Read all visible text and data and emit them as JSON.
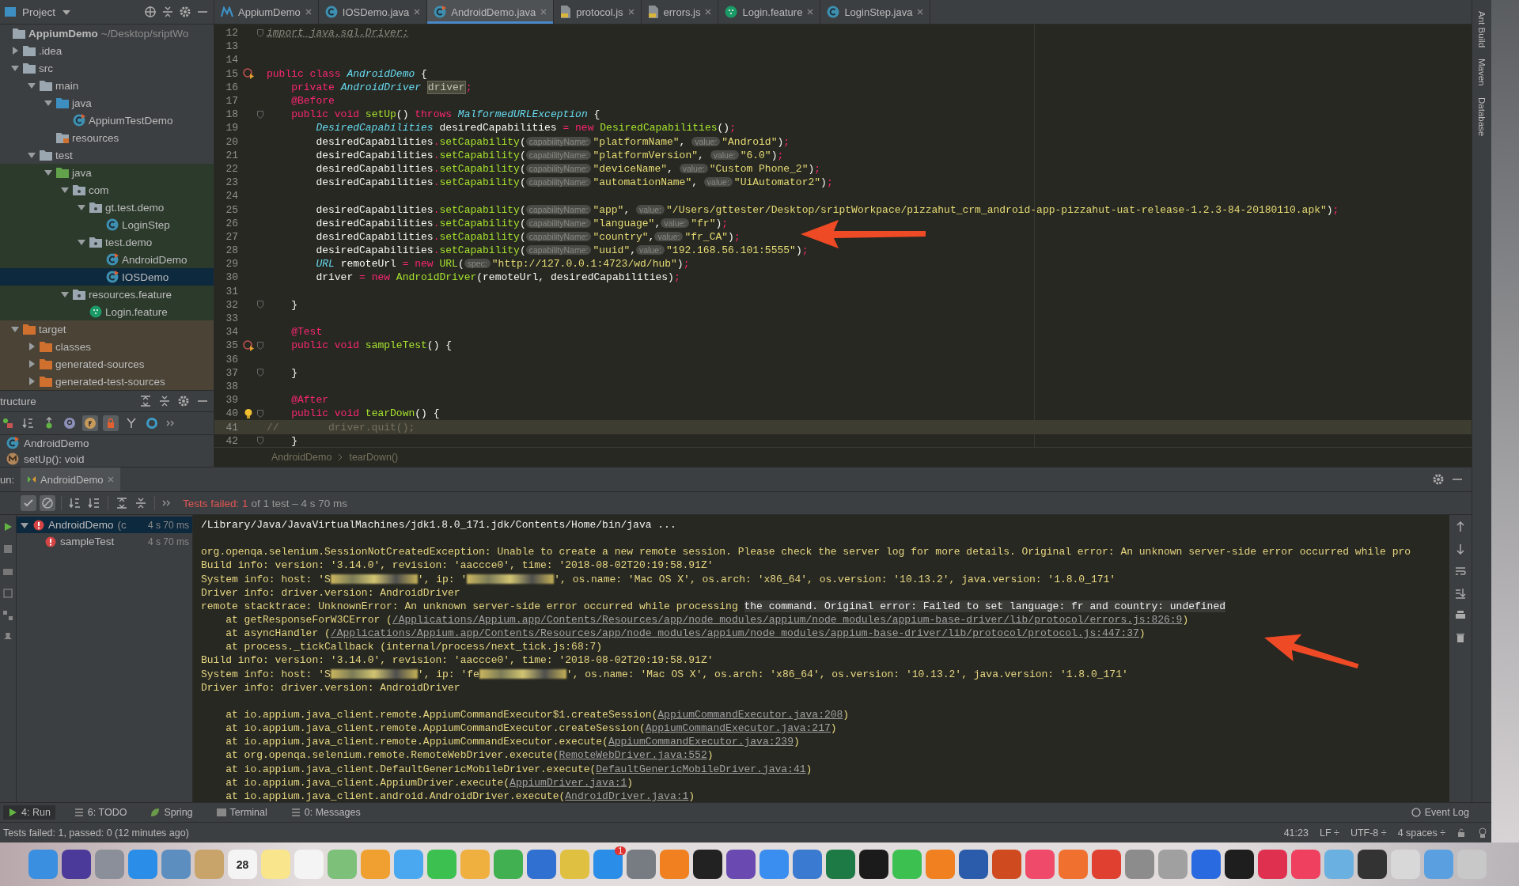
{
  "project_panel": {
    "title": "Project",
    "tree": [
      {
        "label": "AppiumDemo",
        "detail": "~/Desktop/sriptWo",
        "kind": "module",
        "selected": false,
        "children": [
          {
            "label": ".idea",
            "kind": "folder",
            "expanded": false,
            "selected": false
          },
          {
            "label": "src",
            "kind": "folder",
            "expanded": true,
            "selected": false,
            "children": [
              {
                "label": "main",
                "kind": "folder",
                "expanded": true,
                "selected": false,
                "children": [
                  {
                    "label": "java",
                    "kind": "src-folder",
                    "expanded": true,
                    "selected": false,
                    "children": [
                      {
                        "label": "AppiumTestDemo",
                        "kind": "class-run",
                        "selected": false
                      }
                    ]
                  },
                  {
                    "label": "resources",
                    "kind": "res-folder",
                    "selected": false
                  }
                ]
              },
              {
                "label": "test",
                "kind": "folder",
                "expanded": true,
                "selected": false,
                "children": [
                  {
                    "label": "java",
                    "kind": "test-folder",
                    "expanded": true,
                    "test_sources": true,
                    "selected": false,
                    "children": [
                      {
                        "label": "com",
                        "kind": "package",
                        "expanded": true,
                        "selected": false,
                        "children": [
                          {
                            "label": "gt.test.demo",
                            "kind": "package",
                            "expanded": true,
                            "selected": false,
                            "children": [
                              {
                                "label": "LoginStep",
                                "kind": "class",
                                "selected": false
                              }
                            ]
                          },
                          {
                            "label": "test.demo",
                            "kind": "package",
                            "expanded": true,
                            "selected": false,
                            "children": [
                              {
                                "label": "AndroidDemo",
                                "kind": "class-run",
                                "selected": false
                              },
                              {
                                "label": "IOSDemo",
                                "kind": "class-run",
                                "selected": true
                              }
                            ]
                          }
                        ]
                      },
                      {
                        "label": "resources.feature",
                        "kind": "package",
                        "expanded": true,
                        "selected": false,
                        "children": [
                          {
                            "label": "Login.feature",
                            "kind": "feature",
                            "selected": false
                          }
                        ]
                      }
                    ]
                  }
                ]
              }
            ]
          },
          {
            "label": "target",
            "kind": "excluded-folder",
            "expanded": true,
            "excluded": true,
            "selected": false,
            "children": [
              {
                "label": "classes",
                "kind": "excluded-folder",
                "expanded": false,
                "selected": false
              },
              {
                "label": "generated-sources",
                "kind": "excluded-folder",
                "expanded": false,
                "selected": false
              },
              {
                "label": "generated-test-sources",
                "kind": "excluded-folder",
                "expanded": false,
                "selected": false
              }
            ]
          }
        ]
      }
    ]
  },
  "structure_panel": {
    "title": "tructure",
    "tools": [
      {
        "kind": "visibility",
        "on": false
      },
      {
        "kind": "alpha",
        "on": false
      },
      {
        "kind": "inherited",
        "on": false
      },
      {
        "kind": "p",
        "on": false
      },
      {
        "kind": "f",
        "on": true
      },
      {
        "kind": "lock",
        "on": true
      },
      {
        "kind": "tree",
        "on": false
      },
      {
        "kind": "ring",
        "on": false
      }
    ],
    "items": [
      {
        "label": "AndroidDemo",
        "kind": "class-run"
      },
      {
        "label": "setUp(): void",
        "kind": "method"
      }
    ]
  },
  "editor_tabs": [
    {
      "label": "AppiumDemo",
      "kind": "maven",
      "selected": false
    },
    {
      "label": "IOSDemo.java",
      "kind": "class",
      "selected": false
    },
    {
      "label": "AndroidDemo.java",
      "kind": "class-run",
      "selected": true
    },
    {
      "label": "protocol.js",
      "kind": "js",
      "selected": false
    },
    {
      "label": "errors.js",
      "kind": "js",
      "selected": false
    },
    {
      "label": "Login.feature",
      "kind": "feature",
      "selected": false
    },
    {
      "label": "LoginStep.java",
      "kind": "class",
      "selected": false
    }
  ],
  "code_lines": [
    {
      "number": "12",
      "kind": "plain",
      "current": false,
      "fold": true,
      "tokens": [
        {
          "kind": "unused",
          "text": "import java.sql.Driver;"
        }
      ]
    },
    {
      "number": "13",
      "kind": "plain",
      "current": false
    },
    {
      "number": "14",
      "kind": "plain",
      "current": false
    },
    {
      "number": "15",
      "kind": "run",
      "current": false,
      "tokens": [
        {
          "kind": "keyword",
          "text": "public class "
        },
        {
          "kind": "type",
          "text": "AndroidDemo"
        },
        {
          "kind": "plain",
          "text": " {"
        }
      ]
    },
    {
      "number": "16",
      "kind": "plain",
      "current": false,
      "tokens": [
        {
          "kind": "keyword",
          "text": "    private "
        },
        {
          "kind": "type",
          "text": "AndroidDriver "
        },
        {
          "kind": "field",
          "text": "driver"
        },
        {
          "kind": "keyword",
          "text": ";"
        }
      ]
    },
    {
      "number": "17",
      "kind": "plain",
      "current": false,
      "tokens": [
        {
          "kind": "annotation",
          "text": "    @Before"
        }
      ]
    },
    {
      "number": "18",
      "kind": "plain",
      "current": false,
      "fold": true,
      "tokens": [
        {
          "kind": "keyword",
          "text": "    public void "
        },
        {
          "kind": "method",
          "text": "setUp"
        },
        {
          "kind": "plain",
          "text": "() "
        },
        {
          "kind": "keyword",
          "text": "throws "
        },
        {
          "kind": "type",
          "text": "MalformedURLException"
        },
        {
          "kind": "plain",
          "text": " {"
        }
      ]
    },
    {
      "number": "19",
      "kind": "plain",
      "current": false,
      "tokens": [
        {
          "kind": "type",
          "text": "        DesiredCapabilities"
        },
        {
          "kind": "plain",
          "text": " desiredCapabilities "
        },
        {
          "kind": "keyword",
          "text": "= new "
        },
        {
          "kind": "method",
          "text": "DesiredCapabilities"
        },
        {
          "kind": "plain",
          "text": "()"
        },
        {
          "kind": "keyword",
          "text": ";"
        }
      ]
    },
    {
      "number": "20",
      "kind": "plain",
      "current": false,
      "tokens": [
        {
          "kind": "plain",
          "text": "        desiredCapabilities"
        },
        {
          "kind": "keyword",
          "text": "."
        },
        {
          "kind": "method",
          "text": "setCapability"
        },
        {
          "kind": "plain",
          "text": "("
        },
        {
          "kind": "hint",
          "text": "capabilityName:"
        },
        {
          "kind": "string",
          "text": "\"platformName\""
        },
        {
          "kind": "plain",
          "text": ", "
        },
        {
          "kind": "hint",
          "text": "value:"
        },
        {
          "kind": "string",
          "text": "\"Android\""
        },
        {
          "kind": "plain",
          "text": ")"
        },
        {
          "kind": "keyword",
          "text": ";"
        }
      ]
    },
    {
      "number": "21",
      "kind": "plain",
      "current": false,
      "tokens": [
        {
          "kind": "plain",
          "text": "        desiredCapabilities"
        },
        {
          "kind": "keyword",
          "text": "."
        },
        {
          "kind": "method",
          "text": "setCapability"
        },
        {
          "kind": "plain",
          "text": "("
        },
        {
          "kind": "hint",
          "text": "capabilityName:"
        },
        {
          "kind": "string",
          "text": "\"platformVersion\""
        },
        {
          "kind": "plain",
          "text": ", "
        },
        {
          "kind": "hint",
          "text": "value:"
        },
        {
          "kind": "string",
          "text": "\"6.0\""
        },
        {
          "kind": "plain",
          "text": ")"
        },
        {
          "kind": "keyword",
          "text": ";"
        }
      ]
    },
    {
      "number": "22",
      "kind": "plain",
      "current": false,
      "tokens": [
        {
          "kind": "plain",
          "text": "        desiredCapabilities"
        },
        {
          "kind": "keyword",
          "text": "."
        },
        {
          "kind": "method",
          "text": "setCapability"
        },
        {
          "kind": "plain",
          "text": "("
        },
        {
          "kind": "hint",
          "text": "capabilityName:"
        },
        {
          "kind": "string",
          "text": "\"deviceName\""
        },
        {
          "kind": "plain",
          "text": ", "
        },
        {
          "kind": "hint",
          "text": "value:"
        },
        {
          "kind": "string",
          "text": "\"Custom Phone_2\""
        },
        {
          "kind": "plain",
          "text": ")"
        },
        {
          "kind": "keyword",
          "text": ";"
        }
      ]
    },
    {
      "number": "23",
      "kind": "plain",
      "current": false,
      "tokens": [
        {
          "kind": "plain",
          "text": "        desiredCapabilities"
        },
        {
          "kind": "keyword",
          "text": "."
        },
        {
          "kind": "method",
          "text": "setCapability"
        },
        {
          "kind": "plain",
          "text": "("
        },
        {
          "kind": "hint",
          "text": "capabilityName:"
        },
        {
          "kind": "string",
          "text": "\"automationName\""
        },
        {
          "kind": "plain",
          "text": ", "
        },
        {
          "kind": "hint",
          "text": "value:"
        },
        {
          "kind": "string",
          "text": "\"UiAutomator2\""
        },
        {
          "kind": "plain",
          "text": ")"
        },
        {
          "kind": "keyword",
          "text": ";"
        }
      ]
    },
    {
      "number": "24",
      "kind": "plain",
      "current": false
    },
    {
      "number": "25",
      "kind": "plain",
      "current": false,
      "tokens": [
        {
          "kind": "plain",
          "text": "        desiredCapabilities"
        },
        {
          "kind": "keyword",
          "text": "."
        },
        {
          "kind": "method",
          "text": "setCapability"
        },
        {
          "kind": "plain",
          "text": "("
        },
        {
          "kind": "hint",
          "text": "capabilityName:"
        },
        {
          "kind": "string",
          "text": "\"app\""
        },
        {
          "kind": "plain",
          "text": ", "
        },
        {
          "kind": "hint",
          "text": "value:"
        },
        {
          "kind": "string",
          "text": "\"/Users/gttester/Desktop/sriptWorkpace/pizzahut_crm_android-app-pizzahut-uat-release-1.2.3-84-20180110.apk\""
        },
        {
          "kind": "plain",
          "text": ")"
        },
        {
          "kind": "keyword",
          "text": ";"
        }
      ]
    },
    {
      "number": "26",
      "kind": "plain",
      "current": false,
      "tokens": [
        {
          "kind": "plain",
          "text": "        desiredCapabilities"
        },
        {
          "kind": "keyword",
          "text": "."
        },
        {
          "kind": "method",
          "text": "setCapability"
        },
        {
          "kind": "plain",
          "text": "("
        },
        {
          "kind": "hint",
          "text": "capabilityName:"
        },
        {
          "kind": "string",
          "text": "\"language\""
        },
        {
          "kind": "plain",
          "text": ","
        },
        {
          "kind": "hint",
          "text": "value:"
        },
        {
          "kind": "string",
          "text": "\"fr\""
        },
        {
          "kind": "plain",
          "text": ")"
        },
        {
          "kind": "keyword",
          "text": ";"
        }
      ]
    },
    {
      "number": "27",
      "kind": "plain",
      "current": false,
      "tokens": [
        {
          "kind": "plain",
          "text": "        desiredCapabilities"
        },
        {
          "kind": "keyword",
          "text": "."
        },
        {
          "kind": "method",
          "text": "setCapability"
        },
        {
          "kind": "plain",
          "text": "("
        },
        {
          "kind": "hint",
          "text": "capabilityName:"
        },
        {
          "kind": "string",
          "text": "\"country\""
        },
        {
          "kind": "plain",
          "text": ","
        },
        {
          "kind": "hint",
          "text": "value:"
        },
        {
          "kind": "string",
          "text": "\"fr_CA\""
        },
        {
          "kind": "plain",
          "text": ")"
        },
        {
          "kind": "keyword",
          "text": ";"
        }
      ]
    },
    {
      "number": "28",
      "kind": "plain",
      "current": false,
      "tokens": [
        {
          "kind": "plain",
          "text": "        desiredCapabilities"
        },
        {
          "kind": "keyword",
          "text": "."
        },
        {
          "kind": "method",
          "text": "setCapability"
        },
        {
          "kind": "plain",
          "text": "("
        },
        {
          "kind": "hint",
          "text": "capabilityName:"
        },
        {
          "kind": "string",
          "text": "\"uuid\""
        },
        {
          "kind": "plain",
          "text": ","
        },
        {
          "kind": "hint",
          "text": "value:"
        },
        {
          "kind": "string",
          "text": "\"192.168.56.101:5555\""
        },
        {
          "kind": "plain",
          "text": ")"
        },
        {
          "kind": "keyword",
          "text": ";"
        }
      ]
    },
    {
      "number": "29",
      "kind": "plain",
      "current": false,
      "tokens": [
        {
          "kind": "type",
          "text": "        URL"
        },
        {
          "kind": "plain",
          "text": " remoteUrl "
        },
        {
          "kind": "keyword",
          "text": "= new "
        },
        {
          "kind": "method",
          "text": "URL"
        },
        {
          "kind": "plain",
          "text": "("
        },
        {
          "kind": "hint",
          "text": "spec:"
        },
        {
          "kind": "string",
          "text": "\"http://127.0.0.1:4723/wd/hub\""
        },
        {
          "kind": "plain",
          "text": ")"
        },
        {
          "kind": "keyword",
          "text": ";"
        }
      ]
    },
    {
      "number": "30",
      "kind": "plain",
      "current": false,
      "tokens": [
        {
          "kind": "plain",
          "text": "        driver "
        },
        {
          "kind": "keyword",
          "text": "= new "
        },
        {
          "kind": "method",
          "text": "AndroidDriver"
        },
        {
          "kind": "plain",
          "text": "(remoteUrl, desiredCapabilities)"
        },
        {
          "kind": "keyword",
          "text": ";"
        }
      ]
    },
    {
      "number": "31",
      "kind": "plain",
      "current": false
    },
    {
      "number": "32",
      "kind": "plain",
      "current": false,
      "fold": true,
      "tokens": [
        {
          "kind": "plain",
          "text": "    }"
        }
      ]
    },
    {
      "number": "33",
      "kind": "plain",
      "current": false
    },
    {
      "number": "34",
      "kind": "plain",
      "current": false,
      "tokens": [
        {
          "kind": "annotation",
          "text": "    @Test"
        }
      ]
    },
    {
      "number": "35",
      "kind": "run",
      "current": false,
      "fold": true,
      "tokens": [
        {
          "kind": "keyword",
          "text": "    public void "
        },
        {
          "kind": "method",
          "text": "sampleTest"
        },
        {
          "kind": "plain",
          "text": "() {"
        }
      ]
    },
    {
      "number": "36",
      "kind": "plain",
      "current": false
    },
    {
      "number": "37",
      "kind": "plain",
      "current": false,
      "fold": true,
      "tokens": [
        {
          "kind": "plain",
          "text": "    }"
        }
      ]
    },
    {
      "number": "38",
      "kind": "plain",
      "current": false
    },
    {
      "number": "39",
      "kind": "plain",
      "current": false,
      "tokens": [
        {
          "kind": "annotation",
          "text": "    @After"
        }
      ]
    },
    {
      "number": "40",
      "kind": "bulb",
      "current": false,
      "fold": true,
      "tokens": [
        {
          "kind": "keyword",
          "text": "    public void "
        },
        {
          "kind": "method",
          "text": "tearDown"
        },
        {
          "kind": "plain",
          "text": "() {"
        }
      ]
    },
    {
      "number": "41",
      "kind": "plain",
      "current": true,
      "tokens": [
        {
          "kind": "comment",
          "text": "//        driver.quit();"
        }
      ]
    },
    {
      "number": "42",
      "kind": "plain",
      "current": false,
      "fold": true,
      "tokens": [
        {
          "kind": "plain",
          "text": "    }"
        }
      ]
    }
  ],
  "breadcrumb": [
    "AndroidDemo",
    "tearDown()"
  ],
  "side_tools": [
    "Ant Build",
    "Maven",
    "Database"
  ],
  "run_panel": {
    "label": "un:",
    "tab": "AndroidDemo",
    "tools": [
      {
        "kind": "check",
        "on": true
      },
      {
        "kind": "stop",
        "on": true
      },
      {
        "kind": "sort-alpha",
        "on": false
      },
      {
        "kind": "sort-time",
        "on": false
      },
      {
        "kind": "expand",
        "on": false
      },
      {
        "kind": "collapse",
        "on": false
      }
    ],
    "summary": {
      "failed": "Tests failed: 1",
      "rest": "of 1 test – 4 s 70 ms"
    },
    "tests": [
      {
        "label": "AndroidDemo",
        "detail": "(c",
        "time": "4 s 70 ms",
        "expanded": true,
        "selected": true,
        "children": [
          {
            "label": "sampleTest",
            "time": "4 s 70 ms",
            "selected": false
          }
        ]
      }
    ],
    "console": [
      {
        "kind": "output",
        "segments": [
          {
            "kind": "command",
            "text": "/Library/Java/JavaVirtualMachines/jdk1.8.0_171.jdk/Contents/Home/bin/java ..."
          }
        ]
      },
      {
        "kind": "blank"
      },
      {
        "kind": "output",
        "segments": [
          {
            "kind": "text",
            "text": "org.openqa.selenium.SessionNotCreatedException: Unable to create a new remote session. Please check the server log for more details. Original error: An unknown server-side error occurred while pro"
          }
        ]
      },
      {
        "kind": "output",
        "segments": [
          {
            "kind": "text",
            "text": "Build info: version: '3.14.0', revision: 'aaccce0', time: '2018-08-02T20:19:58.91Z'"
          }
        ]
      },
      {
        "kind": "output",
        "segments": [
          {
            "kind": "text",
            "text": "System info: host: 'S"
          },
          {
            "kind": "redacted"
          },
          {
            "kind": "text",
            "text": "', ip: '"
          },
          {
            "kind": "redacted"
          },
          {
            "kind": "text",
            "text": "', os.name: 'Mac OS X', os.arch: 'x86_64', os.version: '10.13.2', java.version: '1.8.0_171'"
          }
        ]
      },
      {
        "kind": "output",
        "segments": [
          {
            "kind": "text",
            "text": "Driver info: driver.version: AndroidDriver"
          }
        ]
      },
      {
        "kind": "output",
        "segments": [
          {
            "kind": "text",
            "text": "remote stacktrace: UnknownError: An unknown server-side error occurred while processing "
          },
          {
            "kind": "highlight",
            "text": "the command. Original error: Failed to set language: fr and country: undefined"
          }
        ]
      },
      {
        "kind": "output",
        "segments": [
          {
            "kind": "text",
            "text": "    at getResponseForW3CError ("
          },
          {
            "kind": "link",
            "text": "/Applications/Appium.app/Contents/Resources/app/node_modules/appium/node_modules/appium-base-driver/lib/protocol/errors.js:826:9"
          },
          {
            "kind": "text",
            "text": ")"
          }
        ]
      },
      {
        "kind": "output",
        "segments": [
          {
            "kind": "text",
            "text": "    at asyncHandler ("
          },
          {
            "kind": "link",
            "text": "/Applications/Appium.app/Contents/Resources/app/node_modules/appium/node_modules/appium-base-driver/lib/protocol/protocol.js:447:37"
          },
          {
            "kind": "text",
            "text": ")"
          }
        ]
      },
      {
        "kind": "output",
        "segments": [
          {
            "kind": "text",
            "text": "    at process._tickCallback (internal/process/next_tick.js:68:7)"
          }
        ]
      },
      {
        "kind": "output",
        "segments": [
          {
            "kind": "text",
            "text": "Build info: version: '3.14.0', revision: 'aaccce0', time: '2018-08-02T20:19:58.91Z'"
          }
        ]
      },
      {
        "kind": "output",
        "segments": [
          {
            "kind": "text",
            "text": "System info: host: 'S"
          },
          {
            "kind": "redacted"
          },
          {
            "kind": "text",
            "text": "', ip: 'fe"
          },
          {
            "kind": "redacted"
          },
          {
            "kind": "text",
            "text": "', os.name: 'Mac OS X', os.arch: 'x86_64', os.version: '10.13.2', java.version: '1.8.0_171'"
          }
        ]
      },
      {
        "kind": "output",
        "segments": [
          {
            "kind": "text",
            "text": "Driver info: driver.version: AndroidDriver"
          }
        ]
      },
      {
        "kind": "blank"
      },
      {
        "kind": "output",
        "segments": [
          {
            "kind": "text",
            "text": "    at io.appium.java_client.remote.AppiumCommandExecutor$1.createSession("
          },
          {
            "kind": "link",
            "text": "AppiumCommandExecutor.java:208"
          },
          {
            "kind": "text",
            "text": ")"
          }
        ]
      },
      {
        "kind": "output",
        "segments": [
          {
            "kind": "text",
            "text": "    at io.appium.java_client.remote.AppiumCommandExecutor.createSession("
          },
          {
            "kind": "link",
            "text": "AppiumCommandExecutor.java:217"
          },
          {
            "kind": "text",
            "text": ")"
          }
        ]
      },
      {
        "kind": "output",
        "segments": [
          {
            "kind": "text",
            "text": "    at io.appium.java_client.remote.AppiumCommandExecutor.execute("
          },
          {
            "kind": "link",
            "text": "AppiumCommandExecutor.java:239"
          },
          {
            "kind": "text",
            "text": ")"
          }
        ]
      },
      {
        "kind": "output",
        "segments": [
          {
            "kind": "text",
            "text": "    at org.openqa.selenium.remote.RemoteWebDriver.execute("
          },
          {
            "kind": "link",
            "text": "RemoteWebDriver.java:552"
          },
          {
            "kind": "text",
            "text": ")"
          }
        ]
      },
      {
        "kind": "output",
        "segments": [
          {
            "kind": "text",
            "text": "    at io.appium.java_client.DefaultGenericMobileDriver.execute("
          },
          {
            "kind": "link",
            "text": "DefaultGenericMobileDriver.java:41"
          },
          {
            "kind": "text",
            "text": ")"
          }
        ]
      },
      {
        "kind": "output",
        "segments": [
          {
            "kind": "text",
            "text": "    at io.appium.java_client.AppiumDriver.execute("
          },
          {
            "kind": "link",
            "text": "AppiumDriver.java:1"
          },
          {
            "kind": "text",
            "text": ")"
          }
        ]
      },
      {
        "kind": "output",
        "segments": [
          {
            "kind": "text",
            "text": "    at io.appium.java_client.android.AndroidDriver.execute("
          },
          {
            "kind": "link",
            "text": "AndroidDriver.java:1"
          },
          {
            "kind": "text",
            "text": ")"
          }
        ]
      }
    ]
  },
  "tool_tabs": [
    {
      "label": "4: Run",
      "kind": "run",
      "selected": true
    },
    {
      "label": "6: TODO",
      "kind": "list",
      "selected": false
    },
    {
      "label": "Spring",
      "kind": "leaf",
      "selected": false
    },
    {
      "label": "Terminal",
      "kind": "terminal",
      "selected": false
    },
    {
      "label": "0: Messages",
      "kind": "list",
      "selected": false
    }
  ],
  "event_log": "Event Log",
  "status_bar": {
    "message": "Tests failed: 1, passed: 0 (12 minutes ago)",
    "items": [
      "41:23",
      "LF ÷",
      "UTF-8 ÷",
      "4 spaces ÷"
    ]
  },
  "dock": [
    {
      "color": "#3b8fe0"
    },
    {
      "color": "#4b3a9a"
    },
    {
      "color": "#8a8f99"
    },
    {
      "color": "#2a8ee8"
    },
    {
      "color": "#5c8fc0"
    },
    {
      "color": "#c9a46a"
    },
    {
      "color": "#f4f4f4",
      "label": "28"
    },
    {
      "color": "#f8e58c"
    },
    {
      "color": "#f4f4f4"
    },
    {
      "color": "#7cc07a"
    },
    {
      "color": "#f0a030"
    },
    {
      "color": "#4aa8f0"
    },
    {
      "color": "#3cc050"
    },
    {
      "color": "#f0b040"
    },
    {
      "color": "#40b050"
    },
    {
      "color": "#3070d0"
    },
    {
      "color": "#e0c040"
    },
    {
      "color": "#2a8ee8",
      "badge": "1"
    },
    {
      "color": "#777b82"
    },
    {
      "color": "#f08020"
    },
    {
      "color": "#222222"
    },
    {
      "color": "#6a4ab0"
    },
    {
      "color": "#3a8ef0"
    },
    {
      "color": "#3a7ad0"
    },
    {
      "color": "#1e7a45"
    },
    {
      "color": "#1b1b1b"
    },
    {
      "color": "#3cc050"
    },
    {
      "color": "#f08020"
    },
    {
      "color": "#2b5cab"
    },
    {
      "color": "#d04a20"
    },
    {
      "color": "#f04a6a"
    },
    {
      "color": "#f07030"
    },
    {
      "color": "#e04030"
    },
    {
      "color": "#8c8c8c"
    },
    {
      "color": "#a0a0a0"
    },
    {
      "color": "#2a6ae0"
    },
    {
      "color": "#1e1e1e"
    },
    {
      "color": "#e03050"
    },
    {
      "color": "#f04060"
    },
    {
      "color": "#6ab0e0"
    },
    {
      "color": "#333333"
    },
    {
      "color": "#d8d8d8"
    },
    {
      "color": "#5aa0e0"
    },
    {
      "color": "#c8c8c8"
    }
  ]
}
